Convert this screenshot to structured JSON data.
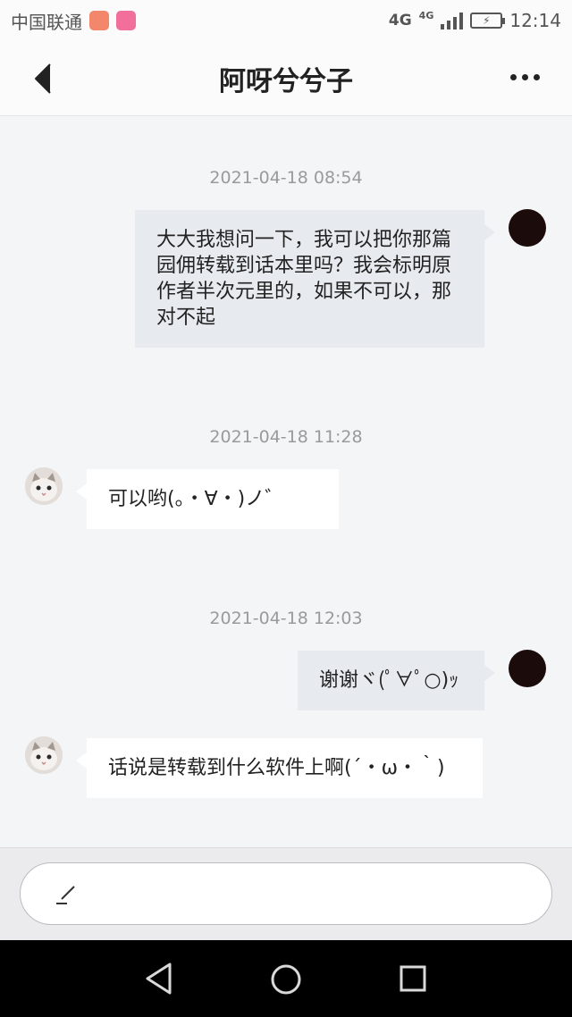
{
  "status_bar": {
    "carrier": "中国联通",
    "network_primary": "4G",
    "network_secondary": "4G",
    "time": "12:14",
    "icons": [
      "app-notification-icon",
      "app-notification-icon",
      "signal-icon",
      "battery-charging-icon"
    ]
  },
  "header": {
    "title": "阿呀兮兮子",
    "back_icon": "back-icon",
    "more_icon": "more-icon"
  },
  "messages": [
    {
      "timestamp": "2021-04-18 08:54",
      "side": "right",
      "text": "大大我想问一下，我可以把你那篇园佣转载到话本里吗？我会标明原作者半次元里的，如果不可以，那对不起"
    },
    {
      "timestamp": "2021-04-18 11:28",
      "side": "left",
      "text": "可以哟(。・∀・)ノ゛"
    },
    {
      "timestamp": "2021-04-18 12:03",
      "side": "right",
      "text": "谢谢ヾ(ﾟ∀ﾟ○)ｯ"
    },
    {
      "timestamp": "",
      "side": "left",
      "text": "话说是转载到什么软件上啊(´・ω・｀)"
    }
  ],
  "input": {
    "icon": "pencil-icon"
  },
  "nav_bar": {
    "icons": [
      "nav-back-icon",
      "nav-home-icon",
      "nav-recent-icon"
    ]
  },
  "colors": {
    "background": "#f4f5f7",
    "bubble_self": "#e7eaee",
    "bubble_other": "#ffffff",
    "timestamp": "#9a9a9a",
    "avatar_self": "#1c0b0b"
  }
}
